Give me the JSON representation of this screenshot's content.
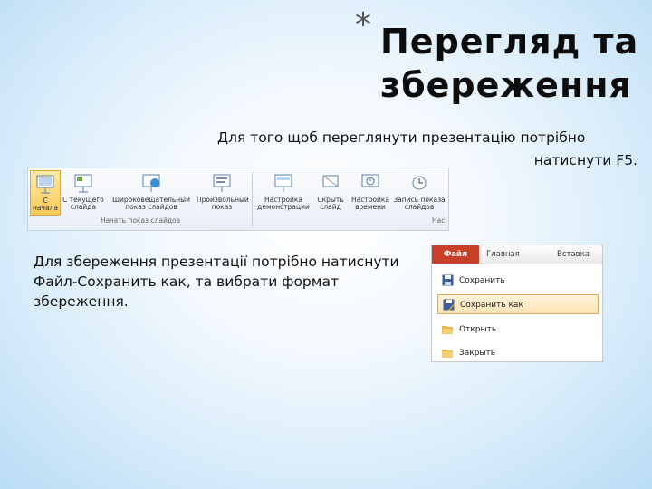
{
  "slide": {
    "bullet": "*",
    "title": "Перегляд та збереження",
    "text1_line1": "Для того щоб переглянути презентацію потрібно",
    "text1_line2": "натиснути F5.",
    "text2": "Для збереження презентації потрібно натиснути Файл-Сохранить как, та вибрати формат збереження."
  },
  "ribbon": {
    "buttons": [
      {
        "label": "С начала"
      },
      {
        "label": "С текущего слайда"
      },
      {
        "label": "Широковещательный показ слайдов"
      },
      {
        "label": "Произвольный показ"
      },
      {
        "label": "Настройка демонстрации"
      },
      {
        "label": "Скрыть слайд"
      },
      {
        "label": "Настройка времени"
      },
      {
        "label": "Запись показа слайдов"
      }
    ],
    "group_label": "Начать показ слайдов",
    "group_label_2": "Нас"
  },
  "filemenu": {
    "tabs": [
      "Файл",
      "Главная",
      "Вставка"
    ],
    "items": [
      "Сохранить",
      "Сохранить как",
      "Открыть",
      "Закрыть"
    ],
    "accent": "#c8402a"
  }
}
